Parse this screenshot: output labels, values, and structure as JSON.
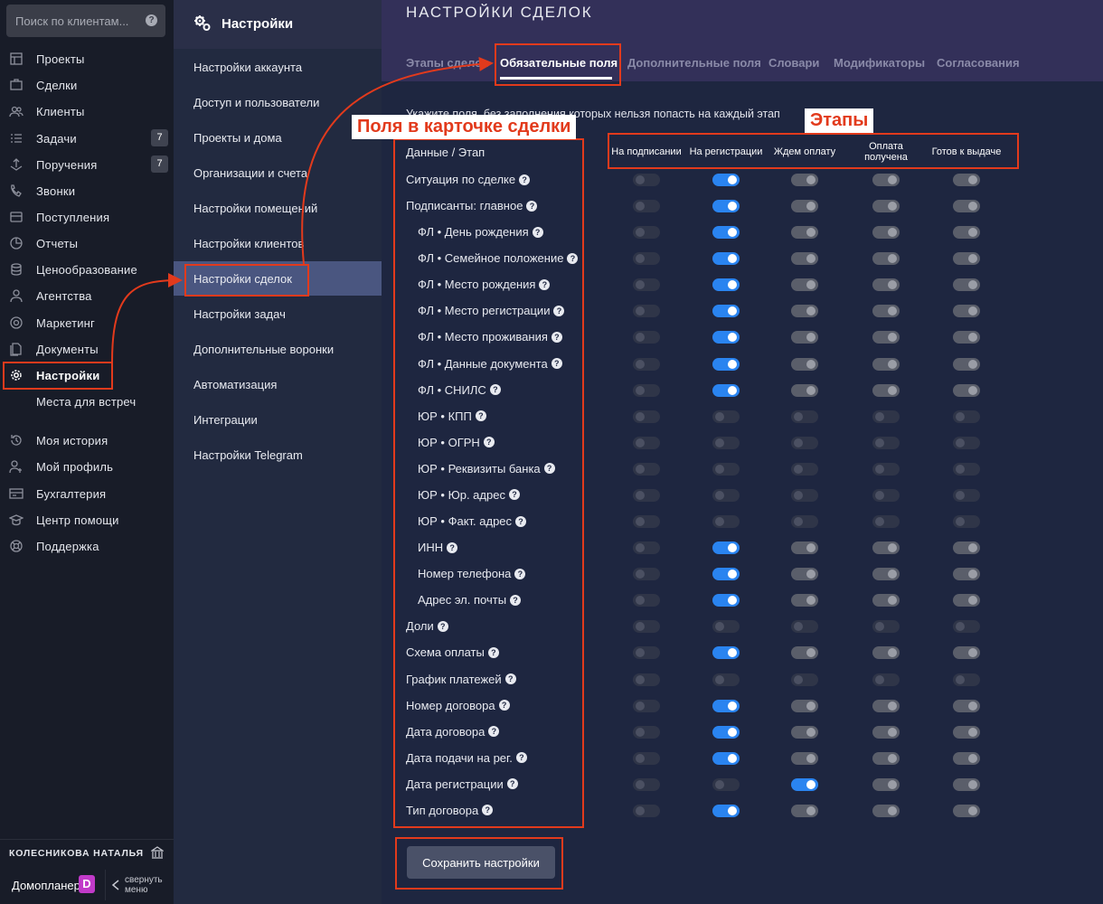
{
  "search": {
    "placeholder": "Поиск по клиентам..."
  },
  "sidebar": {
    "items": [
      {
        "label": "Проекты",
        "icon": "projects-icon",
        "badge": ""
      },
      {
        "label": "Сделки",
        "icon": "deals-icon",
        "badge": ""
      },
      {
        "label": "Клиенты",
        "icon": "clients-icon",
        "badge": ""
      },
      {
        "label": "Задачи",
        "icon": "tasks-icon",
        "badge": "7"
      },
      {
        "label": "Поручения",
        "icon": "assignments-icon",
        "badge": "7"
      },
      {
        "label": "Звонки",
        "icon": "calls-icon",
        "badge": ""
      },
      {
        "label": "Поступления",
        "icon": "receipts-icon",
        "badge": ""
      },
      {
        "label": "Отчеты",
        "icon": "reports-icon",
        "badge": ""
      },
      {
        "label": "Ценообразование",
        "icon": "pricing-icon",
        "badge": ""
      },
      {
        "label": "Агентства",
        "icon": "agencies-icon",
        "badge": ""
      },
      {
        "label": "Маркетинг",
        "icon": "marketing-icon",
        "badge": ""
      },
      {
        "label": "Документы",
        "icon": "documents-icon",
        "badge": ""
      },
      {
        "label": "Настройки",
        "icon": "gear-icon",
        "badge": "",
        "active": true
      },
      {
        "label": "Места для встреч",
        "icon": "meeting-places-icon",
        "badge": ""
      },
      {
        "label": "Моя история",
        "icon": "history-icon",
        "badge": ""
      },
      {
        "label": "Мой профиль",
        "icon": "profile-icon",
        "badge": ""
      },
      {
        "label": "Бухгалтерия",
        "icon": "accounting-icon",
        "badge": ""
      },
      {
        "label": "Центр помощи",
        "icon": "help-center-icon",
        "badge": ""
      },
      {
        "label": "Поддержка",
        "icon": "support-icon",
        "badge": ""
      }
    ]
  },
  "footer": {
    "user_name": "КОЛЕСНИКОВА НАТАЛЬЯ",
    "brand": "Домопланер",
    "brand_logo": "D",
    "collapse_label": "свернуть меню"
  },
  "settings_menu": {
    "title": "Настройки",
    "items": [
      "Настройки аккаунта",
      "Доступ и пользователи",
      "Проекты и дома",
      "Организации и счета",
      "Настройки помещений",
      "Настройки клиентов",
      "Настройки сделок",
      "Настройки задач",
      "Дополнительные воронки",
      "Автоматизация",
      "Интеграции",
      "Настройки Telegram"
    ],
    "active_index": 6
  },
  "main": {
    "title": "НАСТРОЙКИ СДЕЛОК",
    "tabs": [
      "Этапы сделок",
      "Обязательные поля",
      "Дополнительные поля",
      "Словари",
      "Модификаторы",
      "Согласования"
    ],
    "active_tab": 1,
    "hint": "Укажите поля, без заполнения которых нельзя попасть на каждый этап",
    "fields_header": "Данные / Этап",
    "stages": [
      "На подписании",
      "На регистрации",
      "Ждем оплату",
      "Оплата получена",
      "Готов к выдаче"
    ],
    "rows": [
      {
        "label": "Ситуация по сделке",
        "indent": false,
        "states": [
          "off",
          "on",
          "gray",
          "gray",
          "gray"
        ]
      },
      {
        "label": "Подписанты: главное",
        "indent": false,
        "states": [
          "off",
          "on",
          "gray",
          "gray",
          "gray"
        ]
      },
      {
        "label": "ФЛ • День рождения",
        "indent": true,
        "states": [
          "off",
          "on",
          "gray",
          "gray",
          "gray"
        ]
      },
      {
        "label": "ФЛ • Семейное положение",
        "indent": true,
        "states": [
          "off",
          "on",
          "gray",
          "gray",
          "gray"
        ]
      },
      {
        "label": "ФЛ • Место рождения",
        "indent": true,
        "states": [
          "off",
          "on",
          "gray",
          "gray",
          "gray"
        ]
      },
      {
        "label": "ФЛ • Место регистрации",
        "indent": true,
        "states": [
          "off",
          "on",
          "gray",
          "gray",
          "gray"
        ]
      },
      {
        "label": "ФЛ • Место проживания",
        "indent": true,
        "states": [
          "off",
          "on",
          "gray",
          "gray",
          "gray"
        ]
      },
      {
        "label": "ФЛ • Данные документа",
        "indent": true,
        "states": [
          "off",
          "on",
          "gray",
          "gray",
          "gray"
        ]
      },
      {
        "label": "ФЛ • СНИЛС",
        "indent": true,
        "states": [
          "off",
          "on",
          "gray",
          "gray",
          "gray"
        ]
      },
      {
        "label": "ЮР • КПП",
        "indent": true,
        "states": [
          "off",
          "off",
          "off",
          "off",
          "off"
        ]
      },
      {
        "label": "ЮР • ОГРН",
        "indent": true,
        "states": [
          "off",
          "off",
          "off",
          "off",
          "off"
        ]
      },
      {
        "label": "ЮР • Реквизиты банка",
        "indent": true,
        "states": [
          "off",
          "off",
          "off",
          "off",
          "off"
        ]
      },
      {
        "label": "ЮР • Юр. адрес",
        "indent": true,
        "states": [
          "off",
          "off",
          "off",
          "off",
          "off"
        ]
      },
      {
        "label": "ЮР • Факт. адрес",
        "indent": true,
        "states": [
          "off",
          "off",
          "off",
          "off",
          "off"
        ]
      },
      {
        "label": "ИНН",
        "indent": true,
        "states": [
          "off",
          "on",
          "gray",
          "gray",
          "gray"
        ]
      },
      {
        "label": "Номер телефона",
        "indent": true,
        "states": [
          "off",
          "on",
          "gray",
          "gray",
          "gray"
        ]
      },
      {
        "label": "Адрес эл. почты",
        "indent": true,
        "states": [
          "off",
          "on",
          "gray",
          "gray",
          "gray"
        ]
      },
      {
        "label": "Доли",
        "indent": false,
        "states": [
          "off",
          "off",
          "off",
          "off",
          "off"
        ]
      },
      {
        "label": "Схема оплаты",
        "indent": false,
        "states": [
          "off",
          "on",
          "gray",
          "gray",
          "gray"
        ]
      },
      {
        "label": "График платежей",
        "indent": false,
        "states": [
          "off",
          "off",
          "off",
          "off",
          "off"
        ]
      },
      {
        "label": "Номер договора",
        "indent": false,
        "states": [
          "off",
          "on",
          "gray",
          "gray",
          "gray"
        ]
      },
      {
        "label": "Дата договора",
        "indent": false,
        "states": [
          "off",
          "on",
          "gray",
          "gray",
          "gray"
        ]
      },
      {
        "label": "Дата подачи на рег.",
        "indent": false,
        "states": [
          "off",
          "on",
          "gray",
          "gray",
          "gray"
        ]
      },
      {
        "label": "Дата регистрации",
        "indent": false,
        "states": [
          "off",
          "off",
          "on",
          "gray",
          "gray"
        ]
      },
      {
        "label": "Тип договора",
        "indent": false,
        "states": [
          "off",
          "on",
          "gray",
          "gray",
          "gray"
        ]
      }
    ],
    "save_label": "Сохранить настройки"
  },
  "annotations": {
    "fields_callout": "Поля в карточке сделки",
    "stages_callout": "Этапы"
  },
  "colors": {
    "toggle_on": "#2a84f0",
    "highlight_red": "#e23a1c",
    "active_menu": "#4a5680"
  }
}
